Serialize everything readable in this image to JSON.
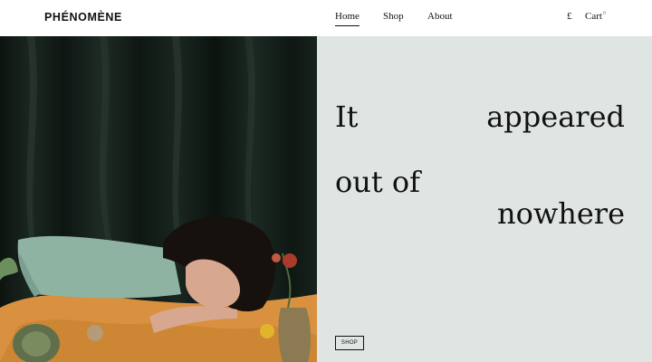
{
  "header": {
    "logo": "PHÉNOMÈNE",
    "nav": [
      {
        "label": "Home"
      },
      {
        "label": "Shop"
      },
      {
        "label": "About"
      }
    ],
    "currency": "£",
    "cart_label": "Cart",
    "cart_count": "0"
  },
  "hero": {
    "headline_words": [
      "It",
      "appeared",
      "out of",
      "nowhere"
    ],
    "button_label": "SHOP"
  }
}
